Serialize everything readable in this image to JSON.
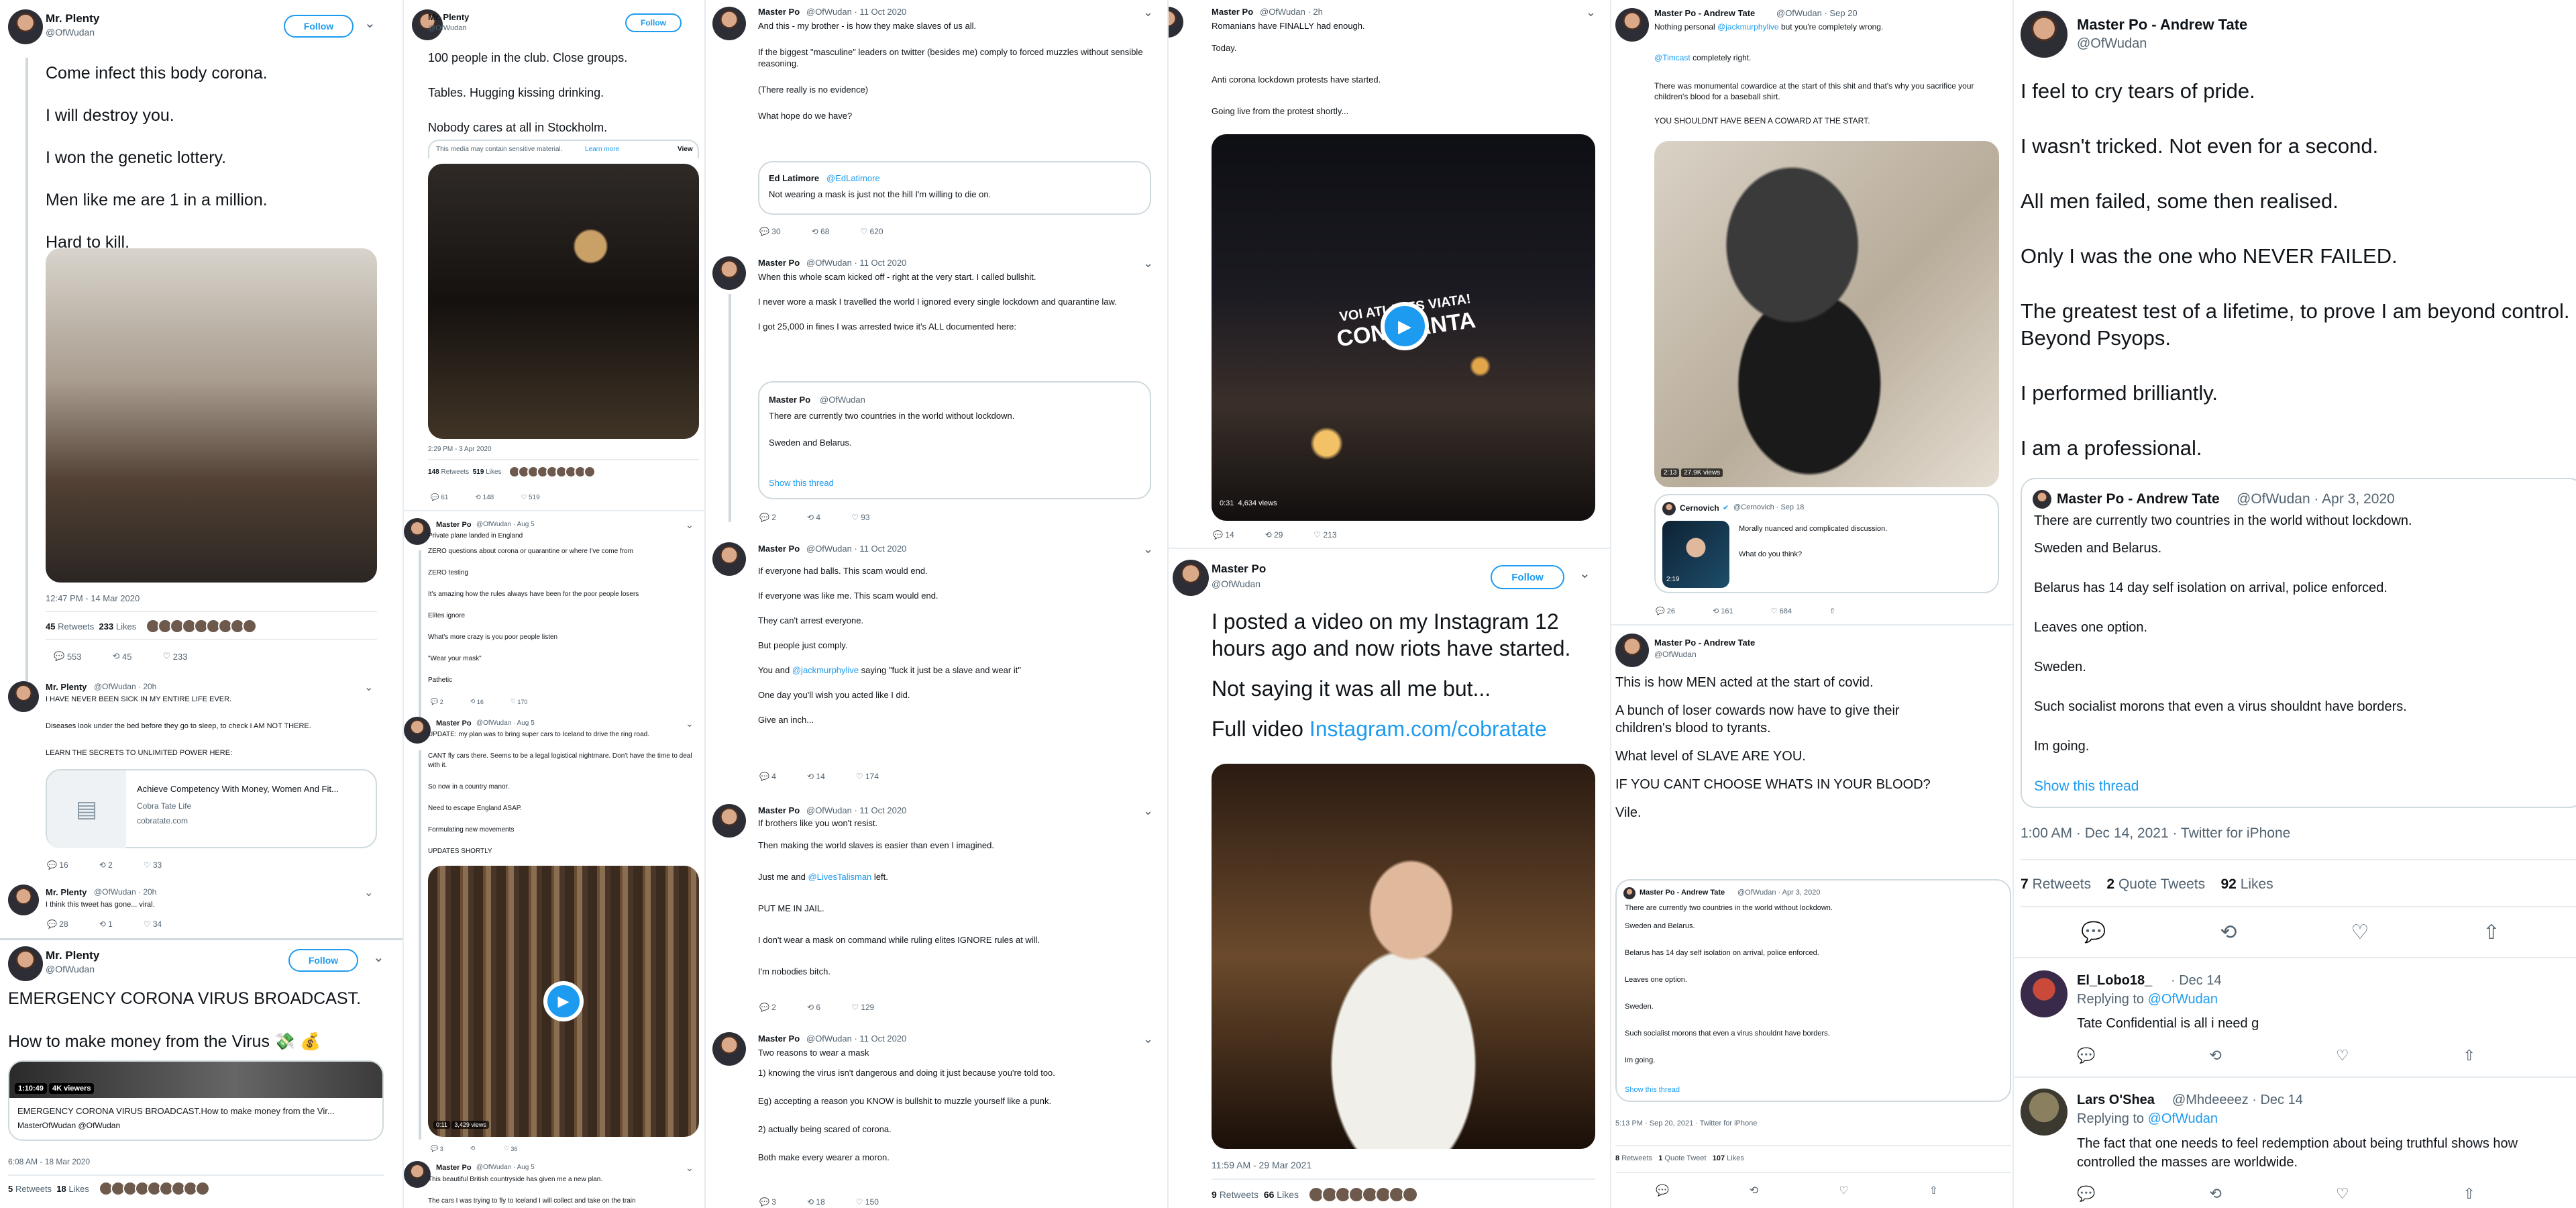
{
  "icons": {
    "reply": "💬",
    "retweet": "⟲",
    "like": "♡",
    "share": "⇧",
    "chevron": "⌄",
    "play": "▶",
    "verified": "✔",
    "card": "▤"
  },
  "colors": {
    "accent": "#1d9bf0",
    "text": "#0f1419",
    "muted": "#536471",
    "border": "#cfd9de"
  },
  "col1": {
    "t1": {
      "name": "Mr. Plenty",
      "handle": "@OfWudan",
      "follow": "Follow",
      "lines": [
        "Come infect this body corona.",
        "I will destroy you.",
        "I won the genetic lottery.",
        "Men like me are 1 in a million.",
        "Hard to kill."
      ],
      "time": "12:47 PM - 14 Mar 2020",
      "retweets_n": "45",
      "retweets_l": "Retweets",
      "likes_n": "233",
      "likes_l": "Likes",
      "reply": "553",
      "rt": "45",
      "like": "233"
    },
    "t2": {
      "name": "Mr. Plenty",
      "handle": "@OfWudan · 20h",
      "lines": [
        "I HAVE NEVER BEEN SICK IN MY ENTIRE LIFE EVER.",
        "Diseases look under the bed before they go to sleep, to check I AM NOT THERE.",
        "LEARN THE SECRETS TO UNLIMITED POWER HERE:"
      ],
      "card_title": "Achieve Competency With Money, Women And Fit...",
      "card_sub": "Cobra Tate Life",
      "card_url": "cobratate.com",
      "reply": "16",
      "rt": "2",
      "like": "33"
    },
    "t3": {
      "name": "Mr. Plenty",
      "handle": "@OfWudan · 20h",
      "text": "I think this tweet has gone... viral.",
      "reply": "28",
      "rt": "1",
      "like": "34"
    },
    "t4": {
      "name": "Mr. Plenty",
      "handle": "@OfWudan",
      "follow": "Follow",
      "line1": "EMERGENCY CORONA VIRUS BROADCAST.",
      "line2": "How to make money from the Virus 💸 💰",
      "views": "1:10:49",
      "views_l": "4K viewers",
      "card_title": "EMERGENCY CORONA VIRUS BROADCAST.How to make money from the Vir...",
      "card_by": "MasterOfWudan @OfWudan",
      "time": "6:08 AM - 18 Mar 2020",
      "retweets_n": "5",
      "retweets_l": "Retweets",
      "likes_n": "18",
      "likes_l": "Likes"
    }
  },
  "col2": {
    "t1": {
      "name": "Mr. Plenty",
      "handle": "@OfWudan",
      "follow": "Follow",
      "lines": [
        "100 people in the club. Close groups.",
        "Tables. Hugging kissing drinking.",
        "Nobody cares at all in Stockholm."
      ],
      "sensitive": "This media may contain sensitive material.",
      "learn": "Learn more",
      "view": "View",
      "time": "2:29 PM - 3 Apr 2020",
      "retweets_n": "148",
      "retweets_l": "Retweets",
      "likes_n": "519",
      "likes_l": "Likes",
      "reply": "61",
      "rt": "148",
      "like": "519"
    },
    "t2": {
      "name": "Master Po",
      "handle": "@OfWudan · Aug 5",
      "lines": [
        "Private plane landed in England",
        "ZERO questions about corona or quarantine or where I've come from",
        "ZERO testing",
        "It's amazing how the rules always have been for the poor people losers",
        "Elites ignore",
        "What's more crazy is you poor people listen",
        "\"Wear your mask\"",
        "Pathetic"
      ],
      "reply": "2",
      "rt": "16",
      "like": "170"
    },
    "t3": {
      "name": "Master Po",
      "handle": "@OfWudan · Aug 5",
      "lines": [
        "UPDATE: my plan was to bring super cars to Iceland to drive the ring road.",
        "CANT fly cars there. Seems to be a legal logistical nightmare. Don't have the time to deal with it.",
        "So now in a country manor.",
        "Need to escape England ASAP.",
        "Formulating new movements",
        "UPDATES SHORTLY"
      ],
      "video_time": "0:11",
      "video_views": "3,429 views",
      "reply": "3",
      "rt": "",
      "like": "36"
    },
    "t4": {
      "name": "Master Po",
      "handle": "@OfWudan · Aug 5",
      "line1": "This beautiful British countryside has given me a new plan.",
      "line2": "The cars I was trying to fly to Iceland I will collect and take on the train"
    }
  },
  "col3": {
    "t0": {
      "name": "Master Po",
      "handle": "@OfWudan · 11 Oct 2020",
      "lines": [
        "And this - my brother - is how they make slaves of us all.",
        "If the biggest \"masculine\" leaders on twitter (besides me) comply to forced muzzles without sensible reasoning.",
        "(There really is no evidence)",
        "What hope do we have?"
      ],
      "quote_name": "Ed Latimore",
      "quote_handle": "@EdLatimore",
      "quote_text": "Not wearing a mask is just not the hill I'm willing to die on.",
      "reply": "30",
      "rt": "68",
      "like": "620"
    },
    "t1": {
      "name": "Master Po",
      "handle": "@OfWudan · 11 Oct 2020",
      "lines": [
        "When this whole scam kicked off - right at the very start. I called bullshit.",
        "I never wore a mask I travelled the world I ignored every single lockdown and quarantine law.",
        "I got 25,000 in fines I was arrested twice it's ALL documented here:"
      ],
      "quote_name": "Master Po",
      "quote_handle": "@OfWudan",
      "quote_l1": "There are currently two countries in the world without lockdown.",
      "quote_l2": "Sweden and Belarus.",
      "show_thread": "Show this thread",
      "reply": "2",
      "rt": "4",
      "like": "93"
    },
    "t2": {
      "name": "Master Po",
      "handle": "@OfWudan · 11 Oct 2020",
      "lines": [
        "If everyone had balls. This scam would end.",
        "If everyone was like me. This scam would end.",
        "They can't arrest everyone.",
        "But people just comply."
      ],
      "l5a": "You and ",
      "l5m": "@jackmurphylive",
      "l5b": " saying \"fuck it just be a slave and wear it\"",
      "l6": "One day you'll wish you acted like I did.",
      "l7": "Give an inch...",
      "reply": "4",
      "rt": "14",
      "like": "174"
    },
    "t3": {
      "name": "Master Po",
      "handle": "@OfWudan · 11 Oct 2020",
      "l1": "If brothers like you won't resist.",
      "l2": "Then making the world slaves is easier than even I imagined.",
      "l3a": "Just me and ",
      "l3m": "@LivesTalisman",
      "l3b": " left.",
      "l4": "PUT ME IN JAIL.",
      "l5": "I don't wear a mask on command while ruling elites IGNORE rules at will.",
      "l6": "I'm nobodies bitch.",
      "reply": "2",
      "rt": "6",
      "like": "129"
    },
    "t4": {
      "name": "Master Po",
      "handle": "@OfWudan · 11 Oct 2020",
      "lines": [
        "Two reasons to wear a mask",
        "1) knowing the virus isn't dangerous and doing it just because you're told too.",
        "Eg) accepting a reason you KNOW is bullshit to muzzle yourself like a punk.",
        "2) actually being scared of corona.",
        "Both make every wearer a moron."
      ],
      "reply": "3",
      "rt": "18",
      "like": "150"
    }
  },
  "col4": {
    "t1": {
      "name": "Master Po",
      "handle": "@OfWudan · 2h",
      "lines": [
        "Romanians have FINALLY had enough.",
        "Today.",
        "Anti corona lockdown protests have started.",
        "Going live from the protest shortly..."
      ],
      "overlay1": "VOI ATI ALES VIATA!",
      "overlay2": "CONSTANTA",
      "video_time": "0:31",
      "video_views": "4,634 views",
      "reply": "14",
      "rt": "29",
      "like": "213"
    },
    "t2": {
      "name": "Master Po",
      "handle": "@OfWudan",
      "follow": "Follow",
      "l1": "I posted a video on my Instagram 12 hours ago and now riots have started.",
      "l2": "Not saying it was all me but...",
      "l3": "Full video ",
      "l3link": "Instagram.com/cobratate",
      "time": "11:59 AM - 29 Mar 2021",
      "retweets_n": "9",
      "retweets_l": "Retweets",
      "likes_n": "66",
      "likes_l": "Likes"
    }
  },
  "col5": {
    "t1": {
      "name": "Master Po - Andrew Tate",
      "handle": "@OfWudan · Sep 20",
      "l1a": "Nothing personal ",
      "l1m": "@jackmurphylive",
      "l1b": " but you're completely wrong.",
      "l2m": "@Timcast",
      "l2b": " completely right.",
      "l3": "There was monumental cowardice at the start of this shit and that's why you sacrifice your children's blood for a baseball shirt.",
      "l4": "YOU SHOULDNT HAVE BEEN A COWARD AT THE START.",
      "video_time": "2:13",
      "video_views": "27.9K views",
      "q_name": "Cernovich",
      "q_handle": "@Cernovich · Sep 18",
      "q_l1": "Morally nuanced and complicated discussion.",
      "q_l2": "What do you think?",
      "q_time": "2:19",
      "reply": "26",
      "rt": "161",
      "like": "684"
    },
    "t2": {
      "name": "Master Po - Andrew Tate",
      "handle": "@OfWudan",
      "lines": [
        "This is how MEN acted at the start of covid.",
        "A bunch of loser cowards now have to give their children's blood to tyrants.",
        "What level of SLAVE ARE YOU.",
        "IF YOU CANT CHOOSE WHATS IN YOUR BLOOD?",
        "Vile."
      ],
      "q_name": "Master Po - Andrew Tate",
      "q_handle": "@OfWudan · Apr 3, 2020",
      "q_lines": [
        "There are currently two countries in the world without lockdown.",
        "Sweden and Belarus.",
        "Belarus has 14 day self isolation on arrival, police enforced.",
        "Leaves one option.",
        "Sweden.",
        "Such socialist morons that even a virus shouldnt have borders.",
        "Im going."
      ],
      "show_thread": "Show this thread",
      "time": "5:13 PM · Sep 20, 2021 · Twitter for iPhone",
      "rt_n": "8",
      "rt_l": "Retweets",
      "qt_n": "1",
      "qt_l": "Quote Tweet",
      "likes_n": "107",
      "likes_l": "Likes"
    }
  },
  "col6": {
    "name": "Master Po - Andrew Tate",
    "handle": "@OfWudan",
    "lines": [
      "I feel to cry tears of pride.",
      "I wasn't tricked. Not even for a second.",
      "All men failed, some then realised.",
      "Only I was the one who NEVER FAILED.",
      "The greatest test of a lifetime, to prove I am beyond control. Beyond Psyops.",
      "I performed brilliantly.",
      "I am a professional."
    ],
    "q_name": "Master Po - Andrew Tate",
    "q_handle": "@OfWudan · Apr 3, 2020",
    "q_lines": [
      "There are currently two countries in the world without lockdown.",
      "Sweden and Belarus.",
      "Belarus has 14 day self isolation on arrival, police enforced.",
      "Leaves one option.",
      "Sweden.",
      "Such socialist morons that even a virus shouldnt have borders.",
      "Im going."
    ],
    "show_thread": "Show this thread",
    "time": "1:00 AM · Dec 14, 2021 · Twitter for iPhone",
    "rt_n": "7",
    "rt_l": "Retweets",
    "qt_n": "2",
    "qt_l": "Quote Tweets",
    "likes_n": "92",
    "likes_l": "Likes",
    "r1": {
      "name": "El_Lobo18_",
      "meta": "· Dec 14",
      "replying": "Replying to ",
      "mention": "@OfWudan",
      "text": "Tate Confidential is all i need g"
    },
    "r2": {
      "name": "Lars O'Shea",
      "meta": "@Mhdeeeez · Dec 14",
      "replying": "Replying to ",
      "mention": "@OfWudan",
      "text": "The fact that one needs to feel redemption about being truthful shows how controlled the masses are worldwide."
    }
  }
}
